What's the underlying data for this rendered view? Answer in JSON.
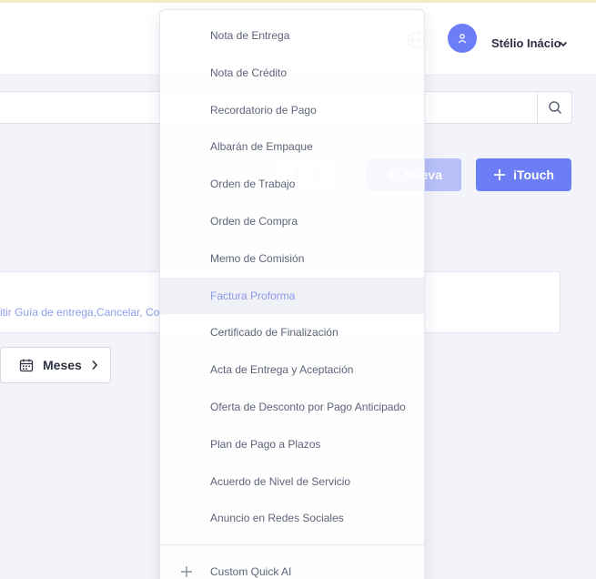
{
  "header": {
    "username": "Stélio Inácio",
    "icons": {
      "language": "globe-icon",
      "user": "user-icon",
      "dropdown": "chevron-down-icon"
    }
  },
  "search": {
    "placeholder": "",
    "icon": "search-icon"
  },
  "toolbar": {
    "ai_label": "AI",
    "new_label": "Nueva",
    "itouch_label": "iTouch",
    "accent": "#6c7ef5"
  },
  "info": {
    "text": "itir Guía de entrega,Cancelar, Cot"
  },
  "period": {
    "label": "Meses",
    "icon": "calendar-icon"
  },
  "dropdown": {
    "items": [
      {
        "label": "Nota de Entrega",
        "active": false
      },
      {
        "label": "Nota de Crédito",
        "active": false
      },
      {
        "label": "Recordatorio de Pago",
        "active": false
      },
      {
        "label": "Albarán de Empaque",
        "active": false
      },
      {
        "label": "Orden de Trabajo",
        "active": false
      },
      {
        "label": "Orden de Compra",
        "active": false
      },
      {
        "label": "Memo de Comisión",
        "active": false
      },
      {
        "label": "Factura Proforma",
        "active": true
      },
      {
        "label": "Certificado de Finalización",
        "active": false
      },
      {
        "label": "Acta de Entrega y Aceptación",
        "active": false
      },
      {
        "label": "Oferta de Desconto por Pago Anticipado",
        "active": false
      },
      {
        "label": "Plan de Pago a Plazos",
        "active": false
      },
      {
        "label": "Acuerdo de Nivel de Servicio",
        "active": false
      },
      {
        "label": "Anuncio en Redes Sociales",
        "active": false
      }
    ],
    "custom_label": "Custom Quick AI"
  }
}
